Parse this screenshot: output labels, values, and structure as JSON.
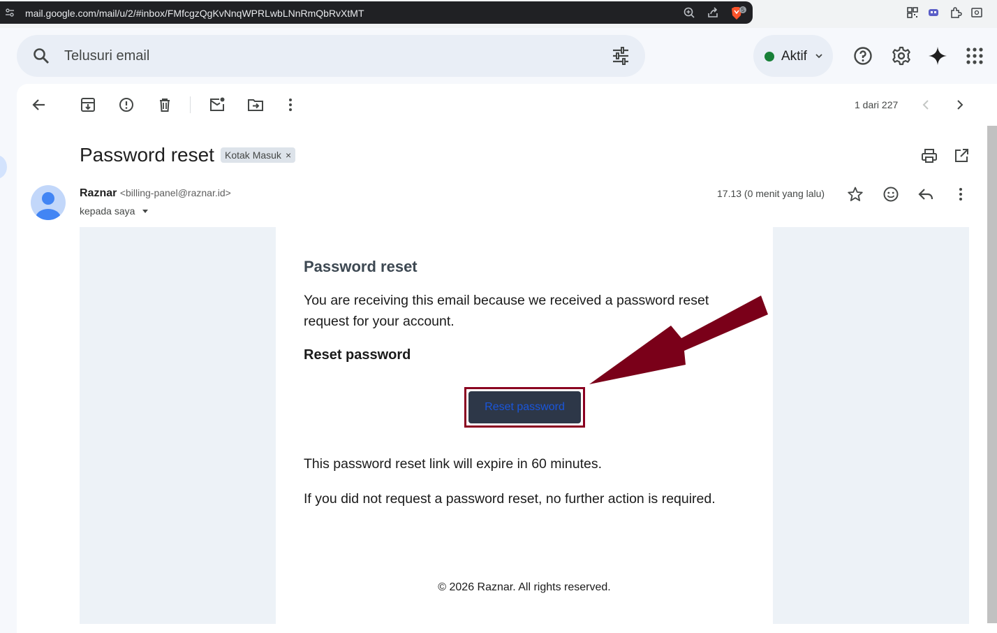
{
  "browser": {
    "url": "mail.google.com/mail/u/2/#inbox/FMfcgzQgKvNnqWPRLwbLNnRmQbRvXtMT",
    "brave_badge": "5"
  },
  "search": {
    "placeholder": "Telusuri email"
  },
  "status": {
    "label": "Aktif",
    "color": "#188038"
  },
  "toolbar": {
    "pager": "1 dari 227"
  },
  "email": {
    "subject": "Password reset",
    "label_chip": "Kotak Masuk",
    "label_remove": "×",
    "sender_name": "Raznar",
    "sender_email": "<billing-panel@raznar.id>",
    "recipient": "kepada saya",
    "time": "17.13 (0 menit yang lalu)"
  },
  "body": {
    "heading": "Password reset",
    "intro": "You are receiving this email because we received a password reset request for your account.",
    "section": "Reset password",
    "button_label": "Reset password",
    "expiry": "This password reset link will expire in 60 minutes.",
    "note": "If you did not request a password reset, no further action is required.",
    "footer": "© 2026 Raznar. All rights reserved."
  },
  "colors": {
    "annotation_arrow": "#7a0019",
    "button_bg": "#2d3748",
    "button_text": "#1a56db"
  }
}
